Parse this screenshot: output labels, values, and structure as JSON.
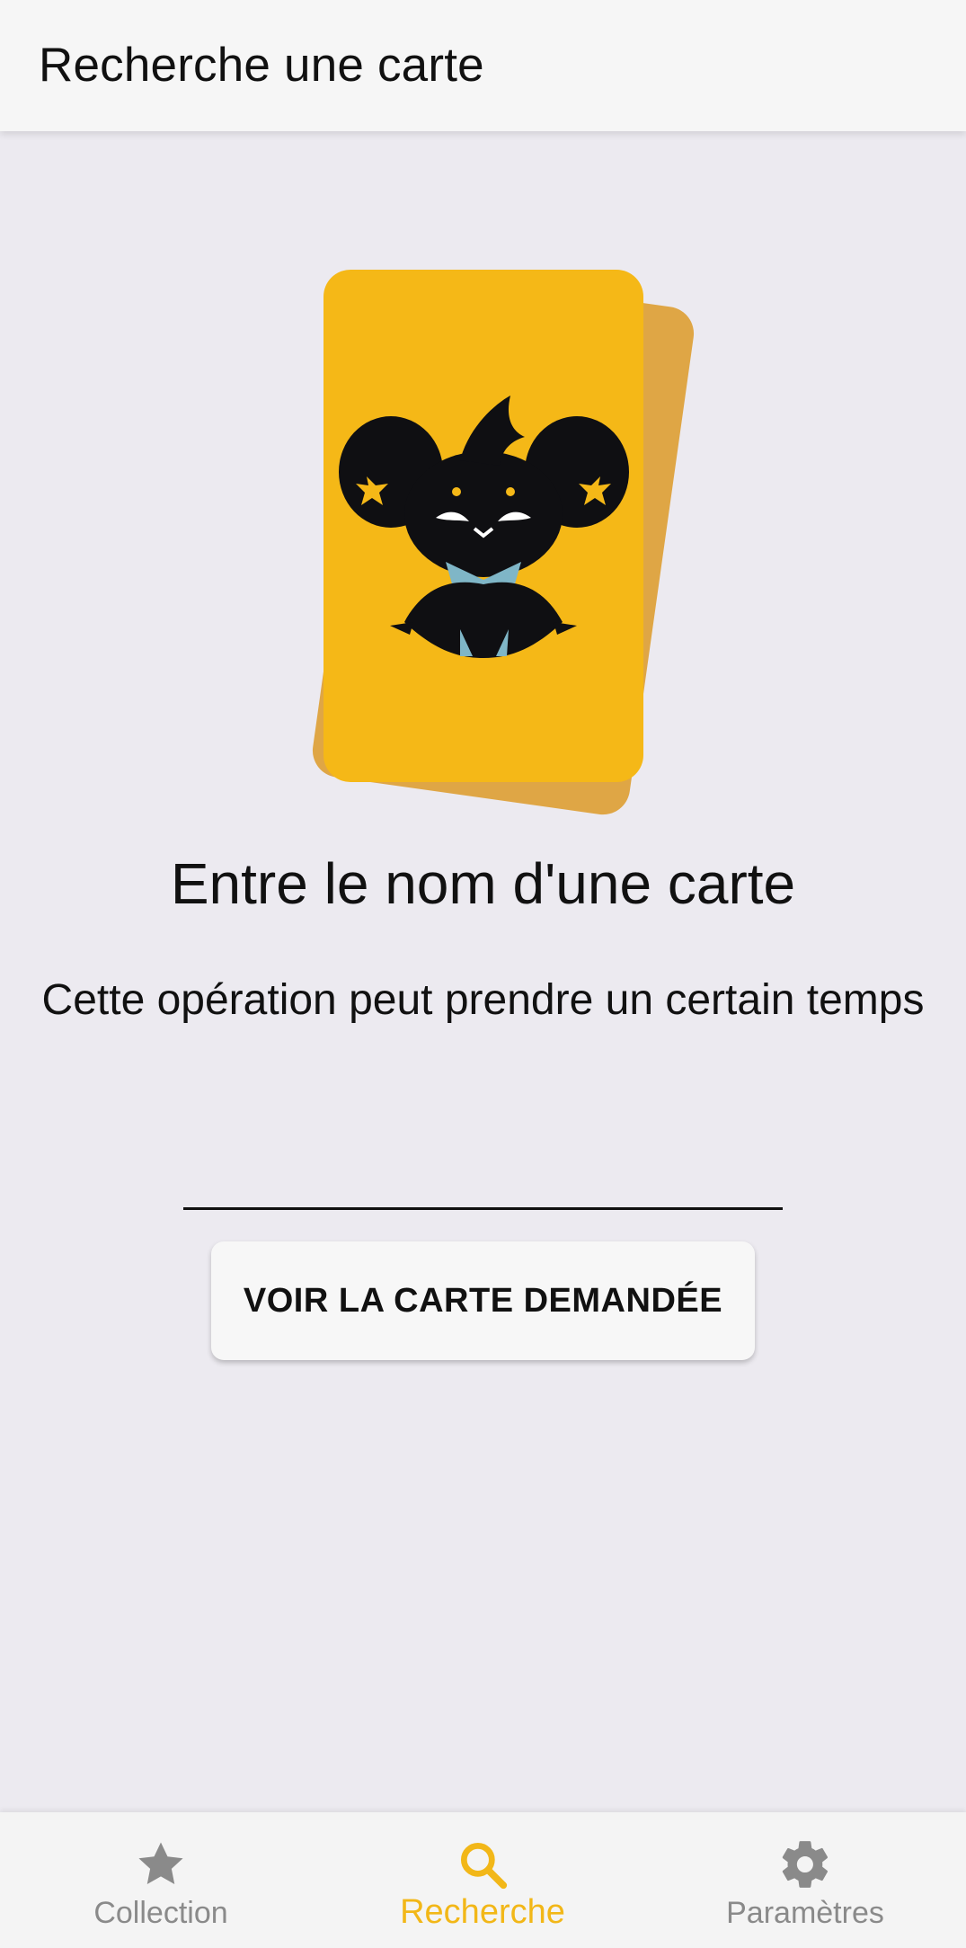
{
  "app_bar": {
    "title": "Recherche une carte"
  },
  "illustration": {
    "icon": "card-stack-mascot",
    "front_card_color": "#f5b817",
    "back_card_color": "#dfa645"
  },
  "main": {
    "heading": "Entre le nom d'une carte",
    "subheading": "Cette opération peut prendre un certain temps",
    "search_input": {
      "value": "",
      "placeholder": ""
    },
    "submit_button_label": "VOIR LA CARTE DEMANDÉE"
  },
  "bottom_nav": {
    "active_color": "#f2b718",
    "inactive_color": "#8a8a8a",
    "items": [
      {
        "label": "Collection",
        "icon": "star-icon",
        "active": false
      },
      {
        "label": "Recherche",
        "icon": "search-icon",
        "active": true
      },
      {
        "label": "Paramètres",
        "icon": "gear-icon",
        "active": false
      }
    ]
  }
}
